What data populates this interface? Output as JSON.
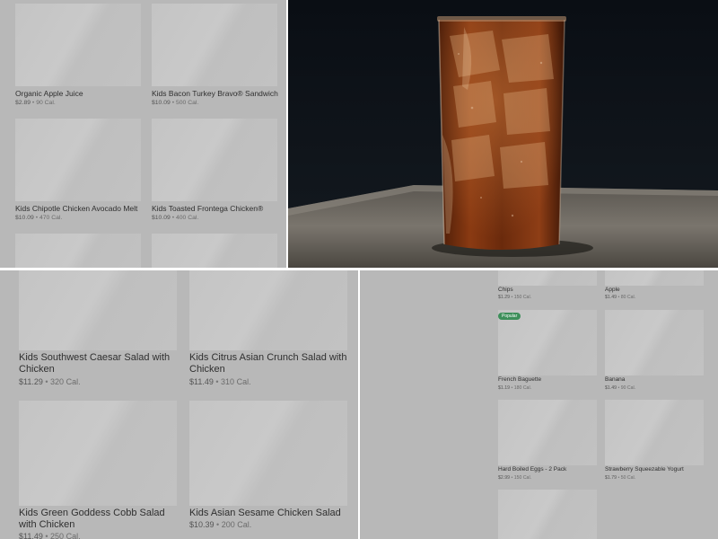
{
  "top_left": {
    "items": [
      {
        "name": "Organic Apple Juice",
        "price": "$2.89",
        "calories": "90 Cal."
      },
      {
        "name": "Kids Bacon Turkey Bravo® Sandwich",
        "price": "$10.09",
        "calories": "500 Cal."
      },
      {
        "name": "Kids Chipotle Chicken Avocado Melt",
        "price": "$10.09",
        "calories": "470 Cal."
      },
      {
        "name": "Kids Toasted Frontega Chicken®",
        "price": "$10.09",
        "calories": "400 Cal."
      }
    ]
  },
  "bottom_left": {
    "items": [
      {
        "name": "Kids Southwest Caesar Salad with Chicken",
        "price": "$11.29",
        "calories": "320 Cal."
      },
      {
        "name": "Kids Citrus Asian Crunch Salad with Chicken",
        "price": "$11.49",
        "calories": "310 Cal."
      },
      {
        "name": "Kids Green Goddess Cobb Salad with Chicken",
        "price": "$11.49",
        "calories": "250 Cal."
      },
      {
        "name": "Kids Asian Sesame Chicken Salad",
        "price": "$10.39",
        "calories": "200 Cal."
      }
    ]
  },
  "bottom_right": {
    "badge": "Popular",
    "items": [
      {
        "name": "Chips",
        "price": "$1.29",
        "calories": "150 Cal."
      },
      {
        "name": "Apple",
        "price": "$1.49",
        "calories": "80 Cal."
      },
      {
        "name": "French Baguette",
        "price": "$1.19",
        "calories": "180 Cal."
      },
      {
        "name": "Banana",
        "price": "$1.49",
        "calories": "90 Cal."
      },
      {
        "name": "Hard Boiled Eggs - 2 Pack",
        "price": "$2.99",
        "calories": "150 Cal."
      },
      {
        "name": "Strawberry Squeezable Yogurt",
        "price": "$1.79",
        "calories": "50 Cal."
      }
    ]
  },
  "separator": "•",
  "colors": {
    "badge": "#3d8f5a",
    "overlay": "#b8b8b8",
    "photo_background": "#0c1014"
  }
}
